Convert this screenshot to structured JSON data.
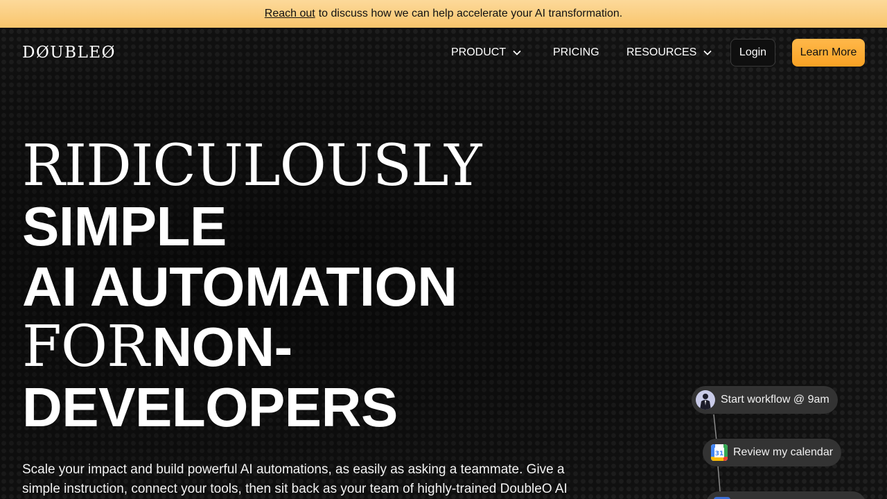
{
  "announcement": {
    "link": "Reach out",
    "text": "to discuss how we can help accelerate your AI transformation."
  },
  "brand": {
    "logo": "DØUBLEØ"
  },
  "nav": {
    "product": "PRODUCT",
    "pricing": "PRICING",
    "resources": "RESOURCES",
    "login": "Login",
    "learn_more": "Learn More"
  },
  "hero": {
    "line1": "RIDICULOUSLY",
    "line2": "SIMPLE",
    "line3": "AI AUTOMATION",
    "line4_a": "FOR",
    "line4_b": "NON-",
    "line5": "DEVELOPERS",
    "subtitle": "Scale your impact and build powerful AI automations, as easily as asking a teammate. Give a simple instruction, connect your tools, then sit back as your team of highly-trained DoubleO AI"
  },
  "workflow": {
    "step1": "Start workflow @ 9am",
    "step2": "Review my calendar",
    "calendar_number": "31"
  },
  "colors": {
    "banner": "#f9c56c",
    "accent_button": "#f9a224",
    "background": "#121212"
  }
}
